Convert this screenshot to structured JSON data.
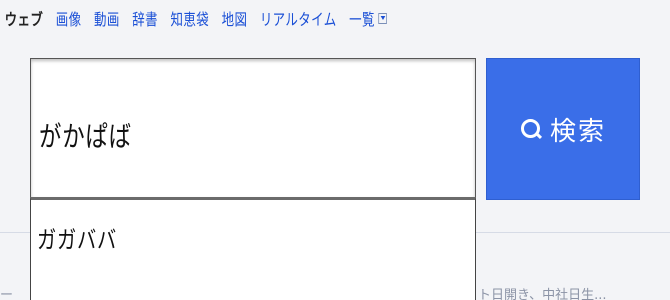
{
  "tabs": [
    {
      "label": "ウェブ",
      "active": true
    },
    {
      "label": "画像",
      "active": false
    },
    {
      "label": "動画",
      "active": false
    },
    {
      "label": "辞書",
      "active": false
    },
    {
      "label": "知恵袋",
      "active": false
    },
    {
      "label": "地図",
      "active": false
    },
    {
      "label": "リアルタイム",
      "active": false
    }
  ],
  "more_label": "一覧",
  "search": {
    "query": "がかぱば",
    "button_label": "検索"
  },
  "suggestions": [
    "ガガババ"
  ],
  "footer": {
    "left_fragment": "ー",
    "right_fragment": "ト日開き、中社日生..."
  },
  "colors": {
    "accent": "#3a6ee8",
    "link": "#1a4fd6",
    "background": "#f3f4f7"
  }
}
